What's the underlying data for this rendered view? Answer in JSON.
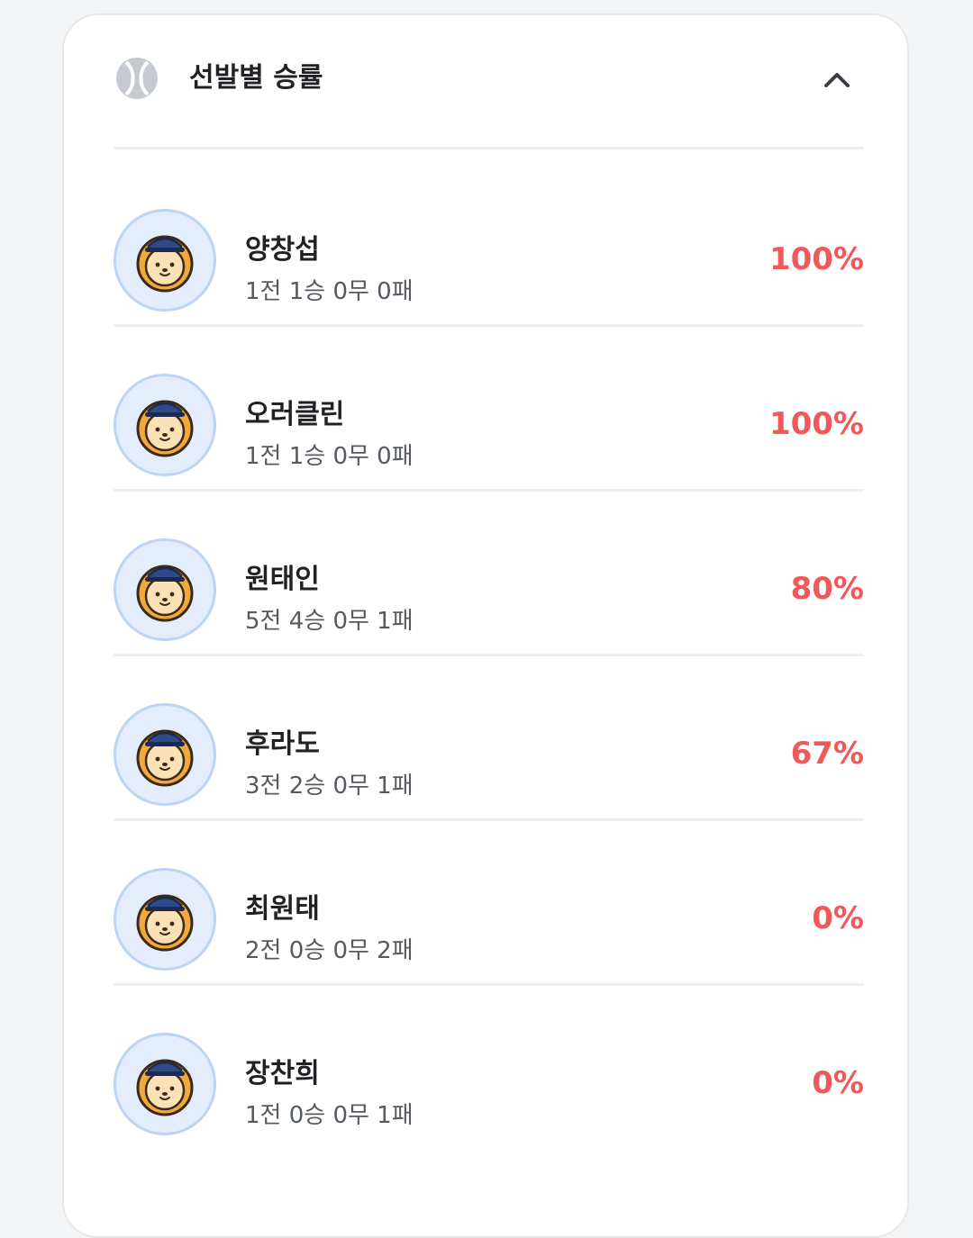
{
  "header": {
    "title": "선발별 승률",
    "icon": "baseball-icon",
    "toggle_icon": "chevron-up-icon"
  },
  "colors": {
    "rate": "#f0585a",
    "avatar_bg": "#e3edfb",
    "avatar_border": "#bdd4f3"
  },
  "pitchers": [
    {
      "name": "양창섭",
      "record": "1전 1승 0무 0패",
      "rate": "100%"
    },
    {
      "name": "오러클린",
      "record": "1전 1승 0무 0패",
      "rate": "100%"
    },
    {
      "name": "원태인",
      "record": "5전 4승 0무 1패",
      "rate": "80%"
    },
    {
      "name": "후라도",
      "record": "3전 2승 0무 1패",
      "rate": "67%"
    },
    {
      "name": "최원태",
      "record": "2전 0승 0무 2패",
      "rate": "0%"
    },
    {
      "name": "장찬희",
      "record": "1전 0승 0무 1패",
      "rate": "0%"
    }
  ]
}
